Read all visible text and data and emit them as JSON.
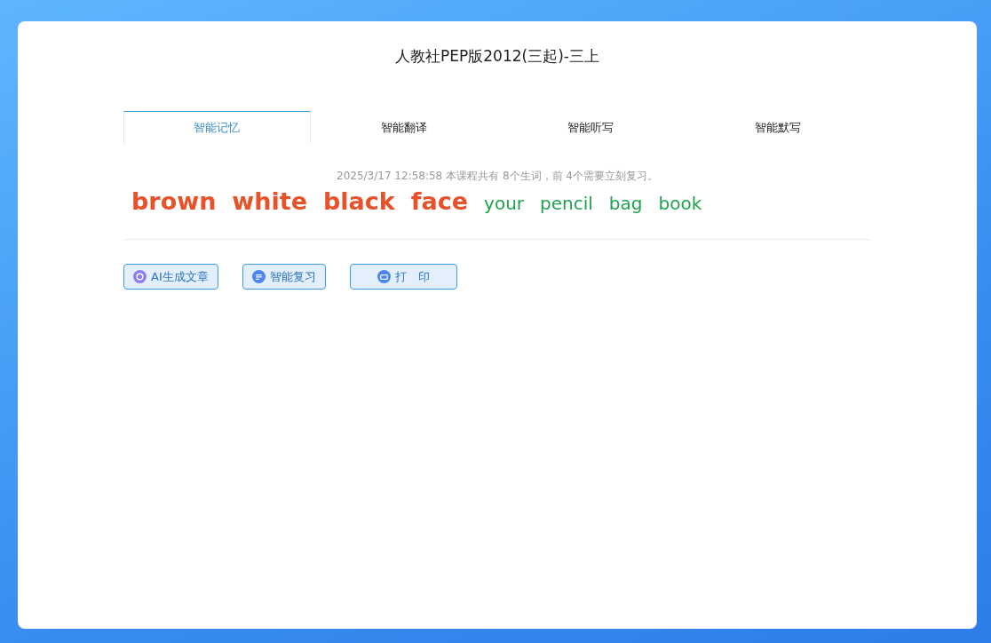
{
  "title": "人教社PEP版2012(三起)-三上",
  "tabs": [
    {
      "label": "智能记忆",
      "selected": true
    },
    {
      "label": "智能翻译",
      "selected": false
    },
    {
      "label": "智能听写",
      "selected": false
    },
    {
      "label": "智能默写",
      "selected": false
    }
  ],
  "summary": "2025/3/17 12:58:58 本课程共有 8个生词，前 4个需要立刻复习。",
  "words": [
    {
      "text": "brown",
      "due": true
    },
    {
      "text": "white",
      "due": true
    },
    {
      "text": "black",
      "due": true
    },
    {
      "text": "face",
      "due": true
    },
    {
      "text": "your",
      "due": false
    },
    {
      "text": "pencil",
      "due": false
    },
    {
      "text": "bag",
      "due": false
    },
    {
      "text": "book",
      "due": false
    }
  ],
  "buttons": [
    {
      "label": "AI生成文章",
      "kind": "ai"
    },
    {
      "label": "智能复习",
      "kind": "review"
    },
    {
      "label": "打　印",
      "kind": "print"
    }
  ]
}
